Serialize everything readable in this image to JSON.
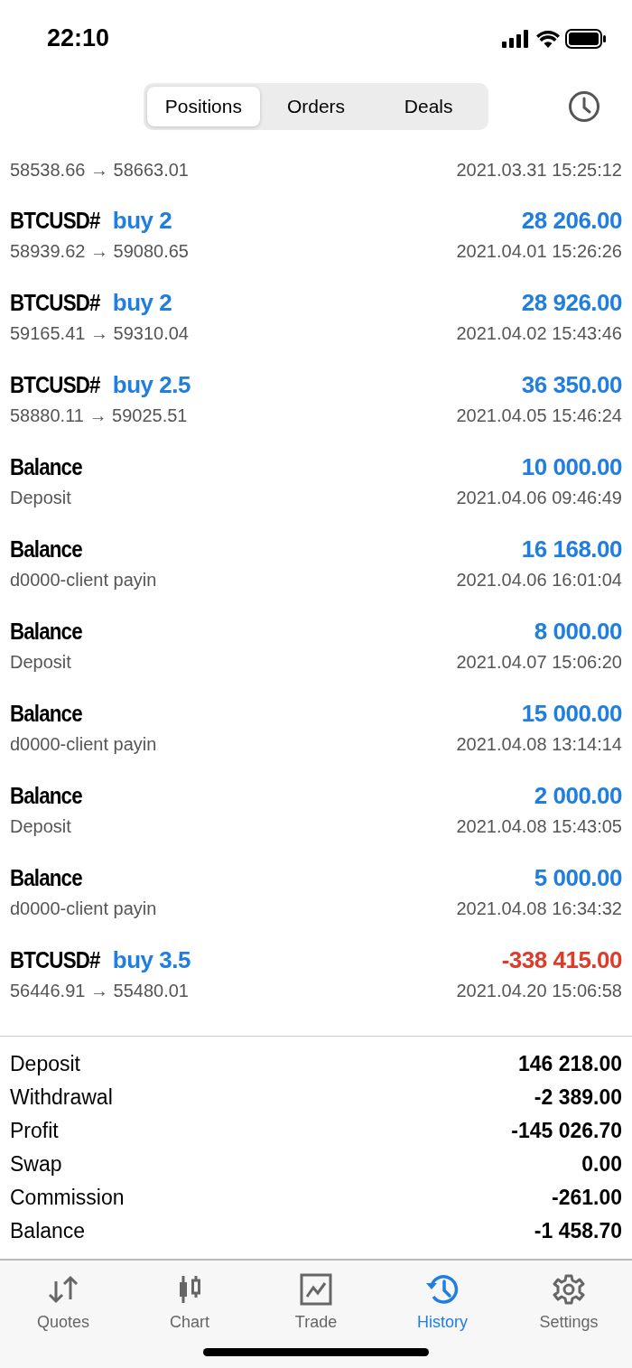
{
  "status_bar": {
    "time": "22:10"
  },
  "tabs": [
    {
      "label": "Positions",
      "selected": true
    },
    {
      "label": "Orders",
      "selected": false
    },
    {
      "label": "Deals",
      "selected": false
    }
  ],
  "rows": [
    {
      "kind": "trade",
      "prices": "58538.66 → 58663.01",
      "time": "2021.03.31 15:25:12"
    },
    {
      "kind": "trade",
      "symbol": "BTCUSD#",
      "action": "buy 2",
      "prices": "58939.62 → 59080.65",
      "amount": "28 206.00",
      "negative": false,
      "time": "2021.04.01 15:26:26"
    },
    {
      "kind": "trade",
      "symbol": "BTCUSD#",
      "action": "buy 2",
      "prices": "59165.41 → 59310.04",
      "amount": "28 926.00",
      "negative": false,
      "time": "2021.04.02 15:43:46"
    },
    {
      "kind": "trade",
      "symbol": "BTCUSD#",
      "action": "buy 2.5",
      "prices": "58880.11 → 59025.51",
      "amount": "36 350.00",
      "negative": false,
      "time": "2021.04.05 15:46:24"
    },
    {
      "kind": "balance",
      "title": "Balance",
      "comment": "Deposit",
      "amount": "10 000.00",
      "negative": false,
      "time": "2021.04.06 09:46:49"
    },
    {
      "kind": "balance",
      "title": "Balance",
      "comment": "d0000-client payin",
      "amount": "16 168.00",
      "negative": false,
      "time": "2021.04.06 16:01:04"
    },
    {
      "kind": "balance",
      "title": "Balance",
      "comment": "Deposit",
      "amount": "8 000.00",
      "negative": false,
      "time": "2021.04.07 15:06:20"
    },
    {
      "kind": "balance",
      "title": "Balance",
      "comment": "d0000-client payin",
      "amount": "15 000.00",
      "negative": false,
      "time": "2021.04.08 13:14:14"
    },
    {
      "kind": "balance",
      "title": "Balance",
      "comment": "Deposit",
      "amount": "2 000.00",
      "negative": false,
      "time": "2021.04.08 15:43:05"
    },
    {
      "kind": "balance",
      "title": "Balance",
      "comment": "d0000-client payin",
      "amount": "5 000.00",
      "negative": false,
      "time": "2021.04.08 16:34:32"
    },
    {
      "kind": "trade",
      "symbol": "BTCUSD#",
      "action": "buy 3.5",
      "prices": "56446.91 → 55480.01",
      "amount": "-338 415.00",
      "negative": true,
      "time": "2021.04.20 15:06:58"
    }
  ],
  "summary": [
    {
      "label": "Deposit",
      "value": "146 218.00"
    },
    {
      "label": "Withdrawal",
      "value": "-2 389.00"
    },
    {
      "label": "Profit",
      "value": "-145 026.70"
    },
    {
      "label": "Swap",
      "value": "0.00"
    },
    {
      "label": "Commission",
      "value": "-261.00"
    },
    {
      "label": "Balance",
      "value": "-1 458.70"
    }
  ],
  "tab_bar": [
    {
      "kind": "quotes",
      "label": "Quotes",
      "selected": false
    },
    {
      "kind": "chart",
      "label": "Chart",
      "selected": false
    },
    {
      "kind": "trade",
      "label": "Trade",
      "selected": false
    },
    {
      "kind": "history",
      "label": "History",
      "selected": true
    },
    {
      "kind": "settings",
      "label": "Settings",
      "selected": false
    }
  ]
}
